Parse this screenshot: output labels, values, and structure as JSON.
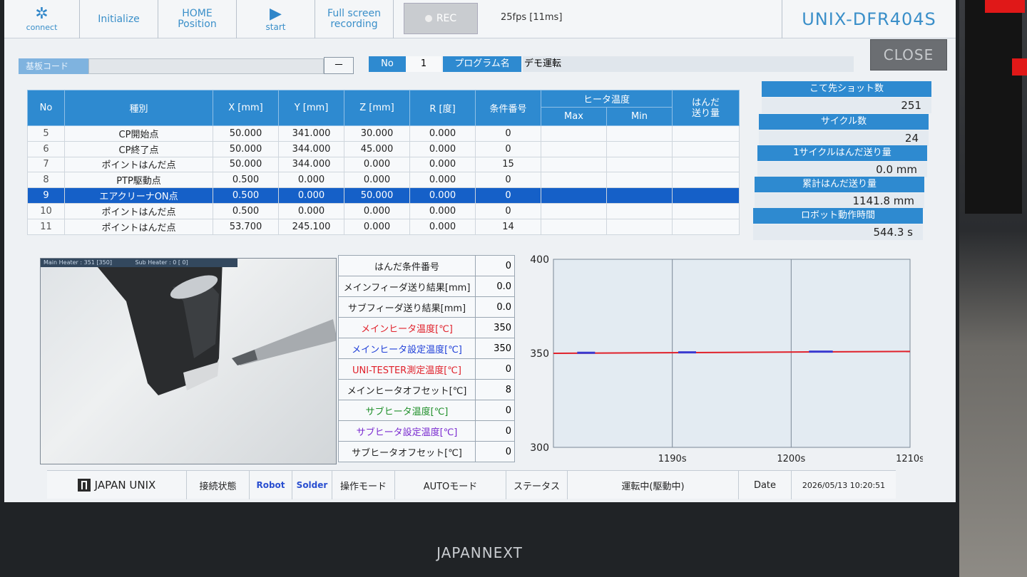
{
  "toolbar": {
    "connect": "connect",
    "initialize": "Initialize",
    "home_line1": "HOME",
    "home_line2": "Position",
    "start": "start",
    "fullscreen_line1": "Full screen",
    "fullscreen_line2": "recording",
    "rec": "REC",
    "fps": "25fps [11ms]",
    "model": "UNIX-DFR404S"
  },
  "program": {
    "code_label": "基板コード",
    "code_dash": "－",
    "no_label": "No",
    "no_value": "1",
    "name_label": "プログラム名",
    "name_value": "デモ運転"
  },
  "close_label": "CLOSE",
  "table": {
    "headers": {
      "no": "No",
      "type": "種別",
      "x": "X [mm]",
      "y": "Y [mm]",
      "z": "Z [mm]",
      "r": "R [度]",
      "cond": "条件番号",
      "heater": "ヒータ温度",
      "max": "Max",
      "min": "Min",
      "feed_line1": "はんだ",
      "feed_line2": "送り量"
    },
    "rows": [
      {
        "no": "5",
        "type": "CP開始点",
        "x": "50.000",
        "y": "341.000",
        "z": "30.000",
        "r": "0.000",
        "cond": "0"
      },
      {
        "no": "6",
        "type": "CP終了点",
        "x": "50.000",
        "y": "344.000",
        "z": "45.000",
        "r": "0.000",
        "cond": "0"
      },
      {
        "no": "7",
        "type": "ポイントはんだ点",
        "x": "50.000",
        "y": "344.000",
        "z": "0.000",
        "r": "0.000",
        "cond": "15"
      },
      {
        "no": "8",
        "type": "PTP駆動点",
        "x": "0.500",
        "y": "0.000",
        "z": "0.000",
        "r": "0.000",
        "cond": "0"
      },
      {
        "no": "9",
        "type": "エアクリーナON点",
        "x": "0.500",
        "y": "0.000",
        "z": "50.000",
        "r": "0.000",
        "cond": "0"
      },
      {
        "no": "10",
        "type": "ポイントはんだ点",
        "x": "0.500",
        "y": "0.000",
        "z": "0.000",
        "r": "0.000",
        "cond": "0"
      },
      {
        "no": "11",
        "type": "ポイントはんだ点",
        "x": "53.700",
        "y": "245.100",
        "z": "0.000",
        "r": "0.000",
        "cond": "14"
      }
    ],
    "selected_index": 4
  },
  "counters": [
    {
      "label": "こて先ショット数",
      "value": "251"
    },
    {
      "label": "サイクル数",
      "value": "24"
    },
    {
      "label": "1サイクルはんだ送り量",
      "value": "0.0 mm"
    },
    {
      "label": "累計はんだ送り量",
      "value": "1141.8 mm"
    },
    {
      "label": "ロボット動作時間",
      "value": "544.3 s"
    }
  ],
  "camera": {
    "overlay_main": "Main Heater : 351 [350]",
    "overlay_sub": "Sub Heater : 0 [ 0]"
  },
  "params": [
    {
      "label": "はんだ条件番号",
      "value": "0",
      "color": "#222222"
    },
    {
      "label": "メインフィーダ送り結果[mm]",
      "value": "0.0",
      "color": "#222222"
    },
    {
      "label": "サブフィーダ送り結果[mm]",
      "value": "0.0",
      "color": "#222222"
    },
    {
      "label": "メインヒータ温度[℃]",
      "value": "350",
      "color": "#e0202a"
    },
    {
      "label": "メインヒータ設定温度[℃]",
      "value": "350",
      "color": "#2040d8"
    },
    {
      "label": "UNI-TESTER測定温度[℃]",
      "value": "0",
      "color": "#e0202a"
    },
    {
      "label": "メインヒータオフセット[℃]",
      "value": "8",
      "color": "#222222"
    },
    {
      "label": "サブヒータ温度[℃]",
      "value": "0",
      "color": "#1f8f2a"
    },
    {
      "label": "サブヒータ設定温度[℃]",
      "value": "0",
      "color": "#7a2ad0"
    },
    {
      "label": "サブヒータオフセット[℃]",
      "value": "0",
      "color": "#222222"
    }
  ],
  "chart_data": {
    "type": "line",
    "ylim": [
      300,
      400
    ],
    "xlim": [
      1180,
      1210
    ],
    "y_ticks": [
      "400",
      "350",
      "300"
    ],
    "x_ticks": [
      {
        "label": "1190s",
        "x": 1190
      },
      {
        "label": "1200s",
        "x": 1200
      },
      {
        "label": "1210s",
        "x": 1210
      }
    ],
    "series": [
      {
        "color": "#e0202a",
        "x": [
          1180,
          1210
        ],
        "y": [
          350,
          351
        ]
      },
      {
        "color": "#3a3ad0",
        "x": [
          1182,
          1183.5,
          1190.5,
          1192,
          1201.5,
          1203.5
        ],
        "y": [
          350.3,
          350.3,
          350.5,
          350.5,
          350.9,
          350.9
        ]
      }
    ]
  },
  "status": {
    "brand": "JAPAN UNIX",
    "conn_label": "接続状態",
    "robot": "Robot",
    "solder": "Solder",
    "mode_label": "操作モード",
    "mode_value": "AUTOモード",
    "status_label": "ステータス",
    "status_value": "運転中(駆動中)",
    "date_label": "Date",
    "date_value": "2026/05/13 10:20:51"
  },
  "monitor_brand": "JAPANNEXT"
}
